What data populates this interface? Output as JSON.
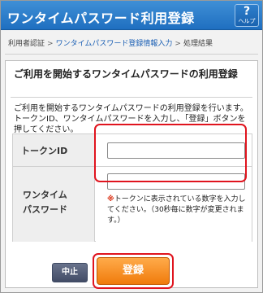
{
  "header": {
    "title": "ワンタイムパスワード利用登録",
    "help_symbol": "?",
    "help_label": "ヘルプ"
  },
  "breadcrumb": {
    "step1": "利用者認証",
    "separator": ">",
    "step2": "ワンタイムパスワード登録情報入力",
    "step3": "処理結果"
  },
  "main": {
    "section_title": "ご利用を開始するワンタイムパスワードの利用登録",
    "description": "ご利用を開始するワンタイムパスワードの利用登録を行います。トークンID、ワンタイムパスワードを入力し、「登録」ボタンを押してください。",
    "form": {
      "token_label": "トークンID",
      "token_value": "",
      "otp_label_line1": "ワンタイム",
      "otp_label_line2": "パスワード",
      "otp_value": "",
      "hint_mark": "※",
      "hint_text": "トークンに表示されている数字を入力してください。（30秒毎に数字が変更されます。）"
    }
  },
  "buttons": {
    "cancel_label": "中止",
    "register_label": "登録"
  },
  "colors": {
    "header_blue": "#2a7ccc",
    "link_blue": "#1a5fb4",
    "register_orange": "#f58a1f",
    "highlight_red": "#e0141e",
    "hint_red": "#d9290c"
  }
}
